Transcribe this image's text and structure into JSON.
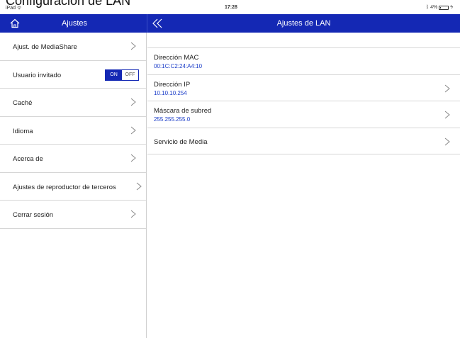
{
  "page_heading": "Configuración de LAN",
  "status_bar": {
    "device": "iPad",
    "time": "17:28",
    "battery": "4%"
  },
  "colors": {
    "navbar": "#1428b4",
    "value_text": "#1a3cc8"
  },
  "sidebar": {
    "title": "Ajustes",
    "home_icon": "home-icon",
    "items": [
      {
        "label": "Ajust. de MediaShare",
        "icon": "chevron-right-icon"
      },
      {
        "label": "Usuario invitado",
        "toggle_on": "ON",
        "toggle_off": "OFF"
      },
      {
        "label": "Caché",
        "icon": "chevron-right-icon"
      },
      {
        "label": "Idioma",
        "icon": "chevron-right-icon"
      },
      {
        "label": "Acerca de",
        "icon": "chevron-right-icon"
      },
      {
        "label": "Ajustes de reproductor de terceros",
        "icon": "chevron-right-icon"
      },
      {
        "label": "Cerrar sesión",
        "icon": "chevron-right-icon"
      }
    ]
  },
  "main": {
    "title": "Ajustes de LAN",
    "back_icon": "double-chevron-left-icon",
    "rows": [
      {
        "title": "Dirección MAC",
        "value": "00:1C:C2:24:A4:10"
      },
      {
        "title": "Dirección IP",
        "value": "10.10.10.254"
      },
      {
        "title": "Máscara de subred",
        "value": "255.255.255.0"
      },
      {
        "title": "Servicio de Media"
      }
    ]
  }
}
